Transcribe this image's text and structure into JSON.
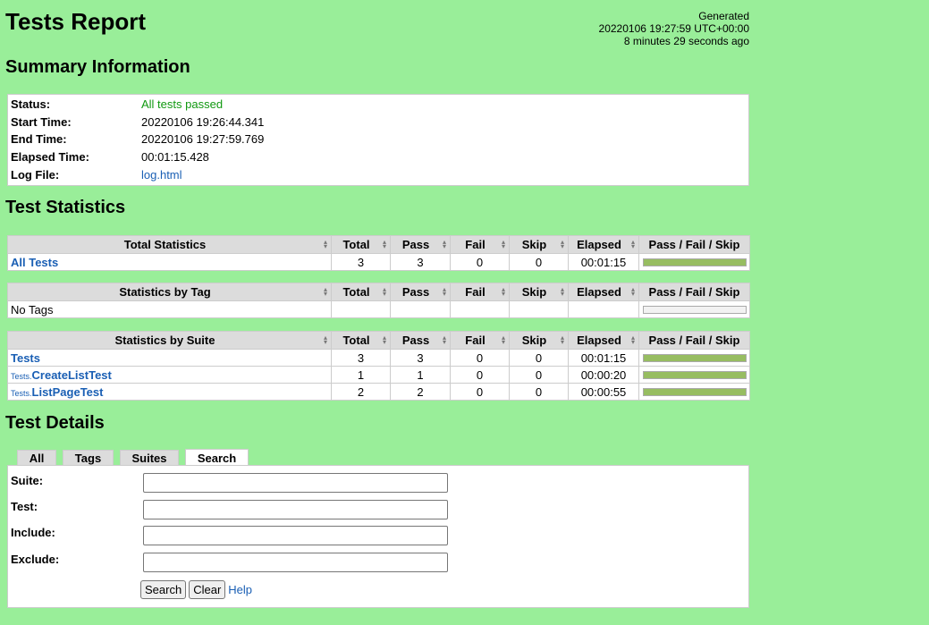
{
  "header": {
    "title": "Tests Report",
    "generated_label": "Generated",
    "generated_time": "20220106 19:27:59 UTC+00:00",
    "generated_ago": "8 minutes 29 seconds ago"
  },
  "summary": {
    "heading": "Summary Information",
    "rows": [
      {
        "label": "Status:",
        "value": "All tests passed"
      },
      {
        "label": "Start Time:",
        "value": "20220106 19:26:44.341"
      },
      {
        "label": "End Time:",
        "value": "20220106 19:27:59.769"
      },
      {
        "label": "Elapsed Time:",
        "value": "00:01:15.428"
      },
      {
        "label": "Log File:",
        "value": "log.html"
      }
    ]
  },
  "statistics": {
    "heading": "Test Statistics",
    "columns": [
      "Total",
      "Pass",
      "Fail",
      "Skip",
      "Elapsed",
      "Pass / Fail / Skip"
    ],
    "total": {
      "header": "Total Statistics",
      "rows": [
        {
          "name": "All Tests",
          "total": "3",
          "pass": "3",
          "fail": "0",
          "skip": "0",
          "elapsed": "00:01:15",
          "pass_ratio": 1
        }
      ]
    },
    "tag": {
      "header": "Statistics by Tag",
      "rows": [
        {
          "name": "No Tags"
        }
      ]
    },
    "suite": {
      "header": "Statistics by Suite",
      "rows": [
        {
          "parent": "",
          "name": "Tests",
          "total": "3",
          "pass": "3",
          "fail": "0",
          "skip": "0",
          "elapsed": "00:01:15",
          "pass_ratio": 1
        },
        {
          "parent": "Tests.",
          "name": "CreateListTest",
          "total": "1",
          "pass": "1",
          "fail": "0",
          "skip": "0",
          "elapsed": "00:00:20",
          "pass_ratio": 1
        },
        {
          "parent": "Tests.",
          "name": "ListPageTest",
          "total": "2",
          "pass": "2",
          "fail": "0",
          "skip": "0",
          "elapsed": "00:00:55",
          "pass_ratio": 1
        }
      ]
    }
  },
  "details": {
    "heading": "Test Details",
    "tabs": [
      "All",
      "Tags",
      "Suites",
      "Search"
    ],
    "active_tab": "Search",
    "fields": [
      {
        "label": "Suite:",
        "value": ""
      },
      {
        "label": "Test:",
        "value": ""
      },
      {
        "label": "Include:",
        "value": ""
      },
      {
        "label": "Exclude:",
        "value": ""
      }
    ],
    "search_button": "Search",
    "clear_button": "Clear",
    "help_link": "Help"
  },
  "colors": {
    "background": "#99ee99",
    "pass": "#97bd61",
    "link": "#1a5fb4"
  }
}
